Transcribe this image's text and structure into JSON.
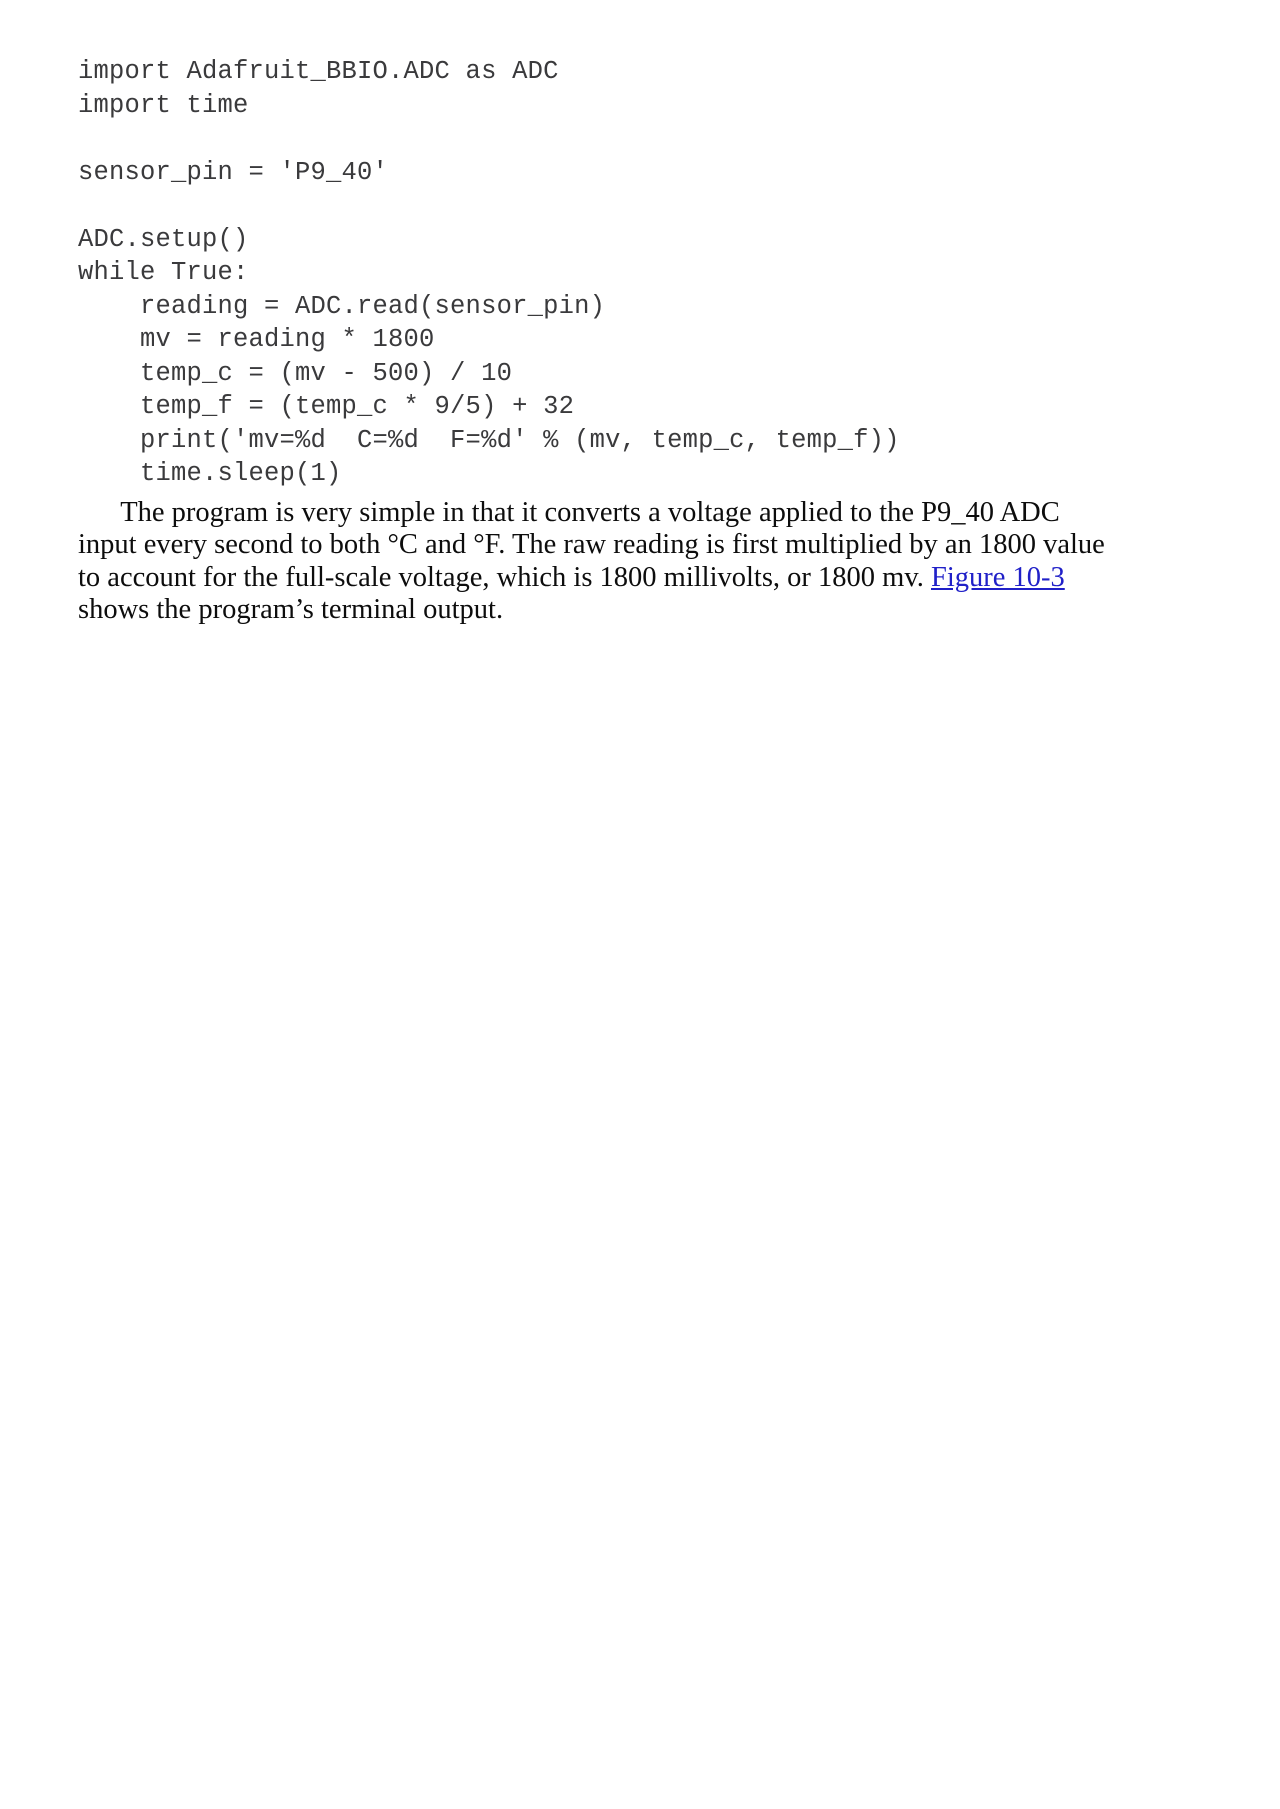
{
  "document": {
    "type": "book-page",
    "background_color": "#ffffff",
    "text_color": "#0d0d0d",
    "code_color": "#3a3a3c",
    "link_color": "#2020c8"
  },
  "code_listing": {
    "language": "python",
    "lines": [
      "import Adafruit_BBIO.ADC as ADC",
      "import time",
      "",
      "sensor_pin = 'P9_40'",
      "",
      "ADC.setup()",
      "while True:",
      "    reading = ADC.read(sensor_pin)",
      "    mv = reading * 1800",
      "    temp_c = (mv - 500) / 10",
      "    temp_f = (temp_c * 9/5) + 32",
      "    print('mv=%d  C=%d  F=%d' % (mv, temp_c, temp_f))",
      "    time.sleep(1)"
    ]
  },
  "paragraph": {
    "lines": [
      {
        "indent": true,
        "segments": [
          {
            "kind": "text",
            "text": "      The program is very simple in that it converts a voltage applied to the P9_40 ADC"
          }
        ]
      },
      {
        "indent": false,
        "segments": [
          {
            "kind": "text",
            "text": "input every second to both °C and °F. The raw reading is first multiplied by an 1800 value"
          }
        ]
      },
      {
        "indent": false,
        "segments": [
          {
            "kind": "text",
            "text": "to account for the full-scale voltage, which is 1800 millivolts, or 1800 mv. "
          },
          {
            "kind": "link",
            "text": "Figure 10-3"
          }
        ]
      },
      {
        "indent": false,
        "segments": [
          {
            "kind": "text",
            "text": "shows the program’s terminal output."
          }
        ]
      }
    ],
    "link_label": "Figure 10-3"
  }
}
